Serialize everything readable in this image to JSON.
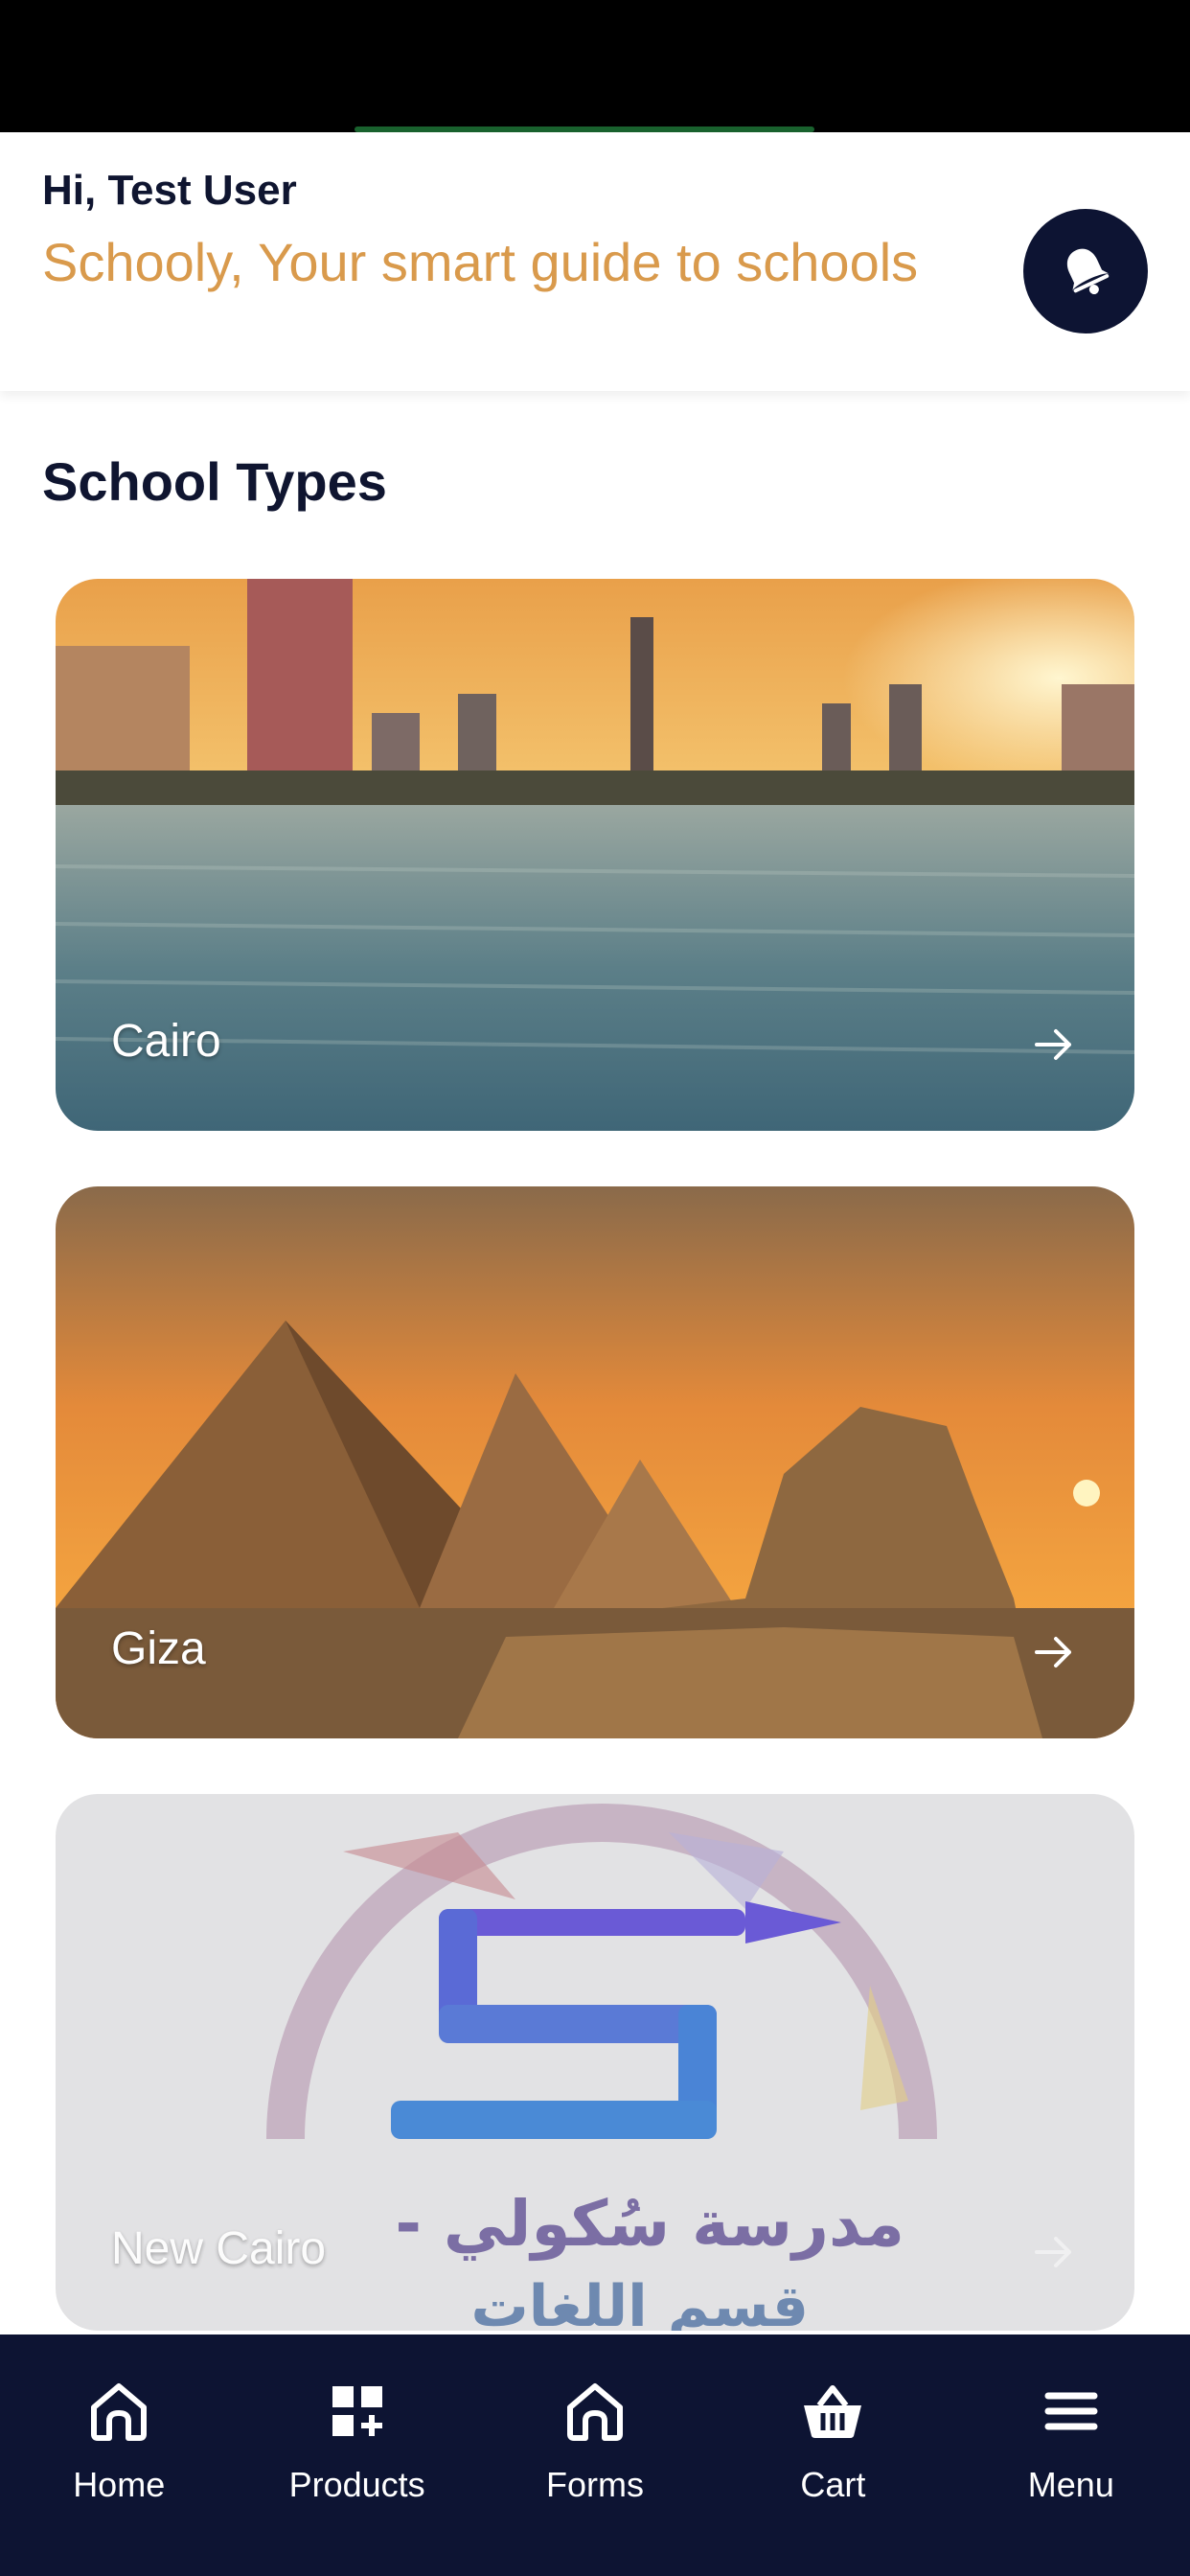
{
  "header": {
    "greeting": "Hi, Test User",
    "tagline": "Schooly, Your smart guide to schools",
    "notification_icon": "bell-icon"
  },
  "section": {
    "title": "School Types"
  },
  "cards": [
    {
      "label": "Cairo",
      "image": "nile-sunset-skyline"
    },
    {
      "label": "Giza",
      "image": "pyramids-sphinx-sunset"
    },
    {
      "label": "New Cairo",
      "image": "school-logo"
    }
  ],
  "new_cairo_logo": {
    "arabic_line1": "مدرسة سُكولي -",
    "arabic_line2": "قسم اللغات"
  },
  "bottom_nav": [
    {
      "label": "Home",
      "icon": "home-icon"
    },
    {
      "label": "Products",
      "icon": "grid-plus-icon"
    },
    {
      "label": "Forms",
      "icon": "home-icon"
    },
    {
      "label": "Cart",
      "icon": "basket-icon"
    },
    {
      "label": "Menu",
      "icon": "hamburger-icon"
    }
  ],
  "colors": {
    "accent": "#d99a4c",
    "navy": "#0d1433",
    "text": "#0f1530"
  }
}
